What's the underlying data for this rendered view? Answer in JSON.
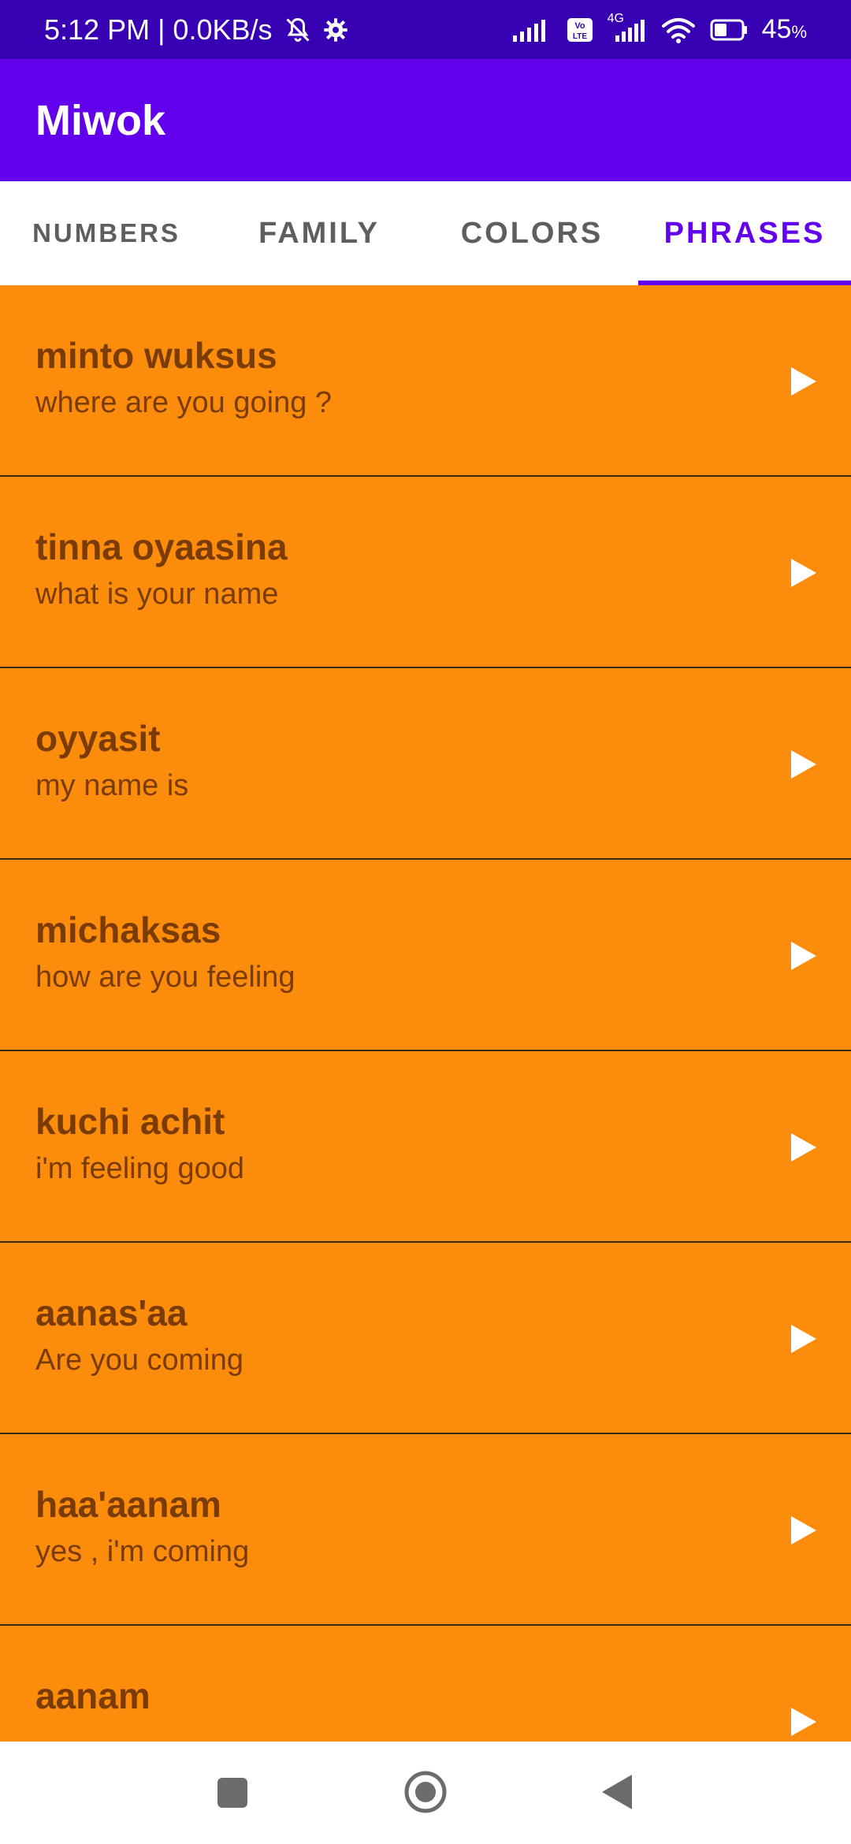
{
  "status_bar": {
    "time": "5:12 PM | 0.0KB/s",
    "battery": "45",
    "battery_unit": "%",
    "network": "4G",
    "icons": [
      "bell-off-icon",
      "gear-icon",
      "signal-icon",
      "volte-icon",
      "signal-icon",
      "wifi-icon",
      "battery-icon"
    ]
  },
  "app_bar": {
    "title": "Miwok"
  },
  "tabs": [
    {
      "label": "NUMBERS",
      "active": false
    },
    {
      "label": "FAMILY",
      "active": false
    },
    {
      "label": "COLORS",
      "active": false
    },
    {
      "label": "PHRASES",
      "active": true
    }
  ],
  "phrases": [
    {
      "miwok": "minto wuksus",
      "english": "where are you going ?"
    },
    {
      "miwok": "tinna oyaasina",
      "english": "what is your name"
    },
    {
      "miwok": "oyyasit",
      "english": "my name is"
    },
    {
      "miwok": "michaksas",
      "english": "how are you feeling"
    },
    {
      "miwok": "kuchi achit",
      "english": "i'm feeling good"
    },
    {
      "miwok": "aanas'aa",
      "english": "Are you coming"
    },
    {
      "miwok": "haa'aanam",
      "english": "yes , i'm coming"
    },
    {
      "miwok": "aanam",
      "english": ""
    }
  ],
  "colors": {
    "status_bar": "#3700b3",
    "app_bar": "#6200ee",
    "accent": "#6200ee",
    "list_bg": "#fb8c0c",
    "list_text": "#7a3b05"
  },
  "nav": {
    "icons": [
      "recents-square-icon",
      "home-circle-icon",
      "back-triangle-icon"
    ]
  }
}
